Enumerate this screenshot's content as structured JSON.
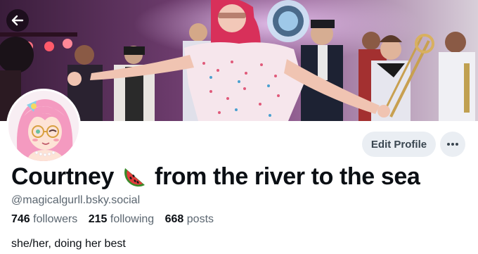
{
  "profile": {
    "display_name_prefix": "Courtney",
    "display_name_suffix": "from the river to the sea",
    "display_name_emoji": "watermelon-icon",
    "handle": "@magicalgurll.bsky.social",
    "bio": "she/her, doing her best"
  },
  "stats": {
    "followers_count": "746",
    "followers_label": "followers",
    "following_count": "215",
    "following_label": "following",
    "posts_count": "668",
    "posts_label": "posts"
  },
  "actions": {
    "edit_profile_label": "Edit Profile"
  },
  "icons": {
    "back": "arrow-left-icon",
    "more": "ellipsis-icon"
  },
  "colors": {
    "button_bg": "#eaeef3",
    "secondary_text": "#5b6670",
    "primary_text": "#0b0f14"
  }
}
